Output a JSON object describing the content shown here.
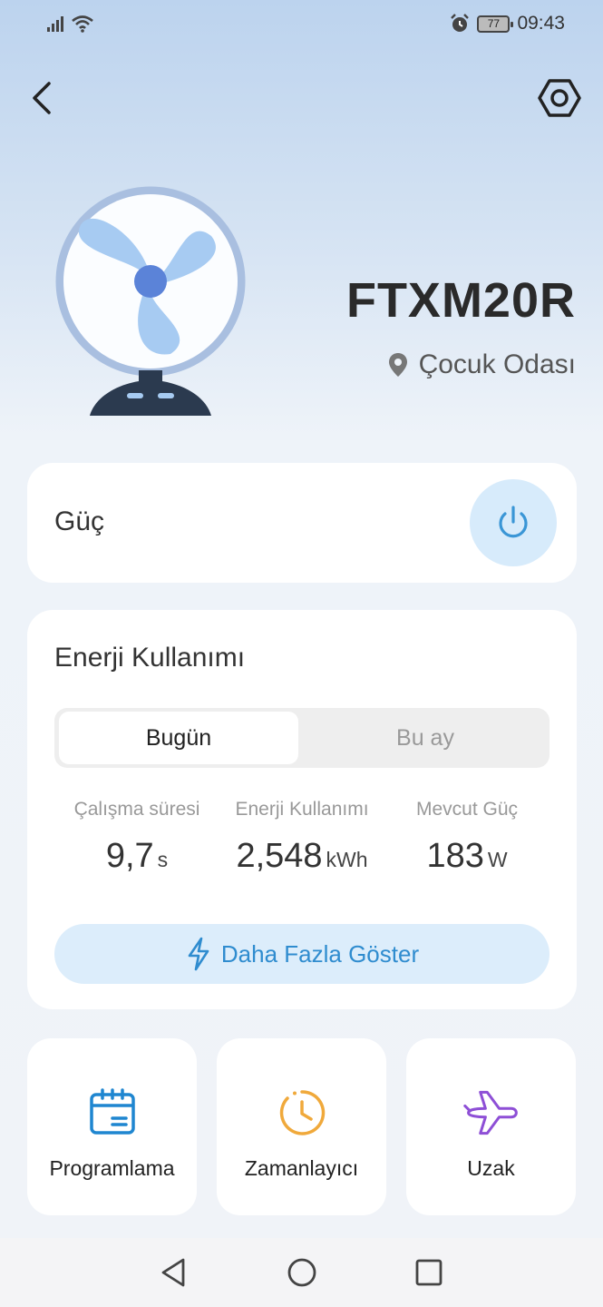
{
  "status_bar": {
    "time": "09:43",
    "battery": "77"
  },
  "device": {
    "name": "FTXM20R",
    "location": "Çocuk Odası"
  },
  "power": {
    "label": "Güç"
  },
  "energy": {
    "title": "Enerji Kullanımı",
    "tabs": [
      {
        "label": "Bugün",
        "active": true
      },
      {
        "label": "Bu ay",
        "active": false
      }
    ],
    "stats": [
      {
        "label": "Çalışma süresi",
        "value": "9,7",
        "unit": "s"
      },
      {
        "label": "Enerji Kullanımı",
        "value": "2,548",
        "unit": "kWh"
      },
      {
        "label": "Mevcut Güç",
        "value": "183",
        "unit": "W"
      }
    ],
    "more_label": "Daha Fazla Göster"
  },
  "features": [
    {
      "label": "Programlama",
      "icon": "calendar-icon",
      "color": "#1f86d0"
    },
    {
      "label": "Zamanlayıcı",
      "icon": "clock-icon",
      "color": "#f0a93b"
    },
    {
      "label": "Uzak",
      "icon": "airplane-icon",
      "color": "#8e4fd6"
    }
  ],
  "colors": {
    "accent": "#2f8ccf",
    "power_bg": "#d7ebfb",
    "fan": "#a7cbf2"
  }
}
